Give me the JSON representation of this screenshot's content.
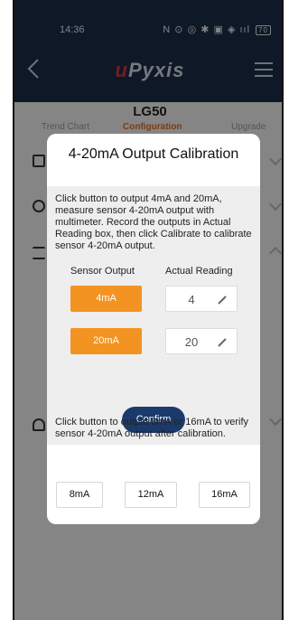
{
  "status_bar": {
    "time": "14:36",
    "icons": "N ⊙ ◎ ✱ ▣ ◈ ııl",
    "battery": "70"
  },
  "header": {
    "logo_prefix": "u",
    "logo_rest": "Pyxis",
    "logo_color": "#d0383c"
  },
  "background": {
    "device_name": "LG50",
    "tabs": [
      "Trend Chart",
      "Configuration",
      "Upgrade"
    ],
    "active_tab_color": "#e26d1b"
  },
  "dialog": {
    "title": "4-20mA Output Calibration",
    "instruction_1": "Click button to output 4mA and 20mA, measure sensor 4-20mA output with multimeter. Record the outputs in Actual Reading box, then click Calibrate to calibrate sensor 4-20mA output.",
    "col_sensor": "Sensor Output",
    "col_actual": "Actual Reading",
    "rows": [
      {
        "output_label": "4mA",
        "actual_value": "4"
      },
      {
        "output_label": "20mA",
        "actual_value": "20"
      }
    ],
    "confirm_label": "Confirm",
    "instruction_2": "Click button to output 8mA or 16mA to verify sensor 4-20mA output after calibration.",
    "check_buttons": [
      "8mA",
      "12mA",
      "16mA"
    ],
    "accent_orange": "#f39321",
    "accent_navy": "#1b3a6b"
  }
}
